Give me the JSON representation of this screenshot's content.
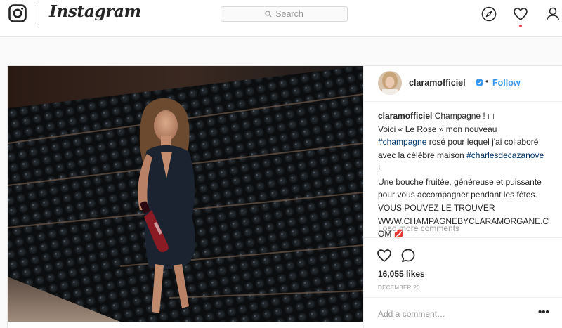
{
  "nav": {
    "brand": "Instagram",
    "search_placeholder": "Search",
    "icons": [
      "instagram-logo-icon",
      "compass-icon",
      "heart-icon",
      "profile-icon"
    ],
    "notification_color": "#ed4956"
  },
  "post": {
    "username": "claramofficiel",
    "follow_label": "Follow",
    "separator": "•",
    "caption": {
      "line1": "Champagne ! ◻",
      "line2_a": "Voici «  Le Rose » mon nouveau",
      "hashtag1": "#champagne",
      "line3_b": " rosé pour lequel j'ai collaboré",
      "line4_a": "avec la célèbre maison ",
      "hashtag2": "#charlesdecazanove",
      "line5": "!",
      "line6": "Une bouche fruitée, généreuse et puissante",
      "line7": "pour vous accompagner pendant les fêtes.",
      "line8": "VOUS POUVEZ LE TROUVER",
      "line9": "WWW.CHAMPAGNEBYCLARAMORGANE.C",
      "line10": "OM 💋"
    },
    "load_more": "Load more comments",
    "likes": "16,055 likes",
    "date": "DECEMBER 20",
    "comment_placeholder": "Add a comment…",
    "more_options": "•••",
    "accent_color": "#3897f0",
    "hashtag_color": "#003569"
  }
}
